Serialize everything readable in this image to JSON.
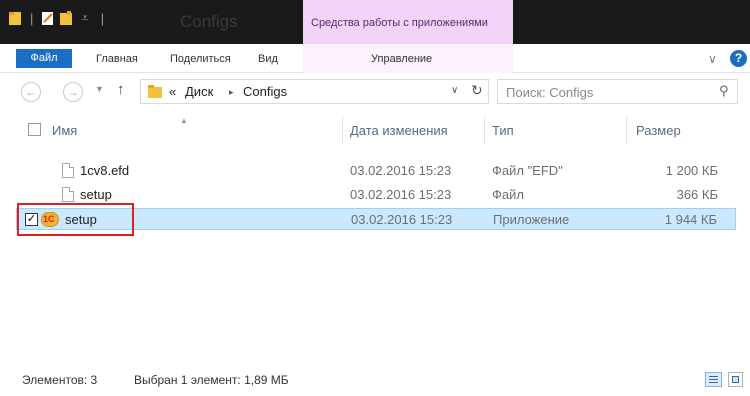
{
  "window": {
    "title": "Configs",
    "context_tools_label": "Средства работы с приложениями"
  },
  "ribbon": {
    "tabs": {
      "file": "Файл",
      "home": "Главная",
      "share": "Поделиться",
      "view": "Вид",
      "manage": "Управление"
    },
    "help_label": "?"
  },
  "address": {
    "overflow": "«",
    "crumbs": [
      "Диск",
      "Configs"
    ],
    "separator": "▸"
  },
  "search": {
    "placeholder": "Поиск: Configs"
  },
  "columns": {
    "name": "Имя",
    "date": "Дата изменения",
    "type": "Тип",
    "size": "Размер"
  },
  "files": [
    {
      "name": "1cv8.efd",
      "date": "03.02.2016 15:23",
      "type": "Файл \"EFD\"",
      "size": "1 200 КБ",
      "icon": "generic-file-icon",
      "selected": false
    },
    {
      "name": "setup",
      "date": "03.02.2016 15:23",
      "type": "Файл",
      "size": "366 КБ",
      "icon": "generic-file-icon",
      "selected": false
    },
    {
      "name": "setup",
      "date": "03.02.2016 15:23",
      "type": "Приложение",
      "size": "1 944 КБ",
      "icon": "1c-app-icon",
      "selected": true
    }
  ],
  "app_icon_text": "1С",
  "status": {
    "items": "Элементов: 3",
    "selection": "Выбран 1 элемент: 1,89 МБ"
  },
  "colors": {
    "file_tab": "#1c6ec4",
    "context_tools": "#f1d4f7",
    "selection": "#cce8ff",
    "highlight": "#e02020"
  }
}
